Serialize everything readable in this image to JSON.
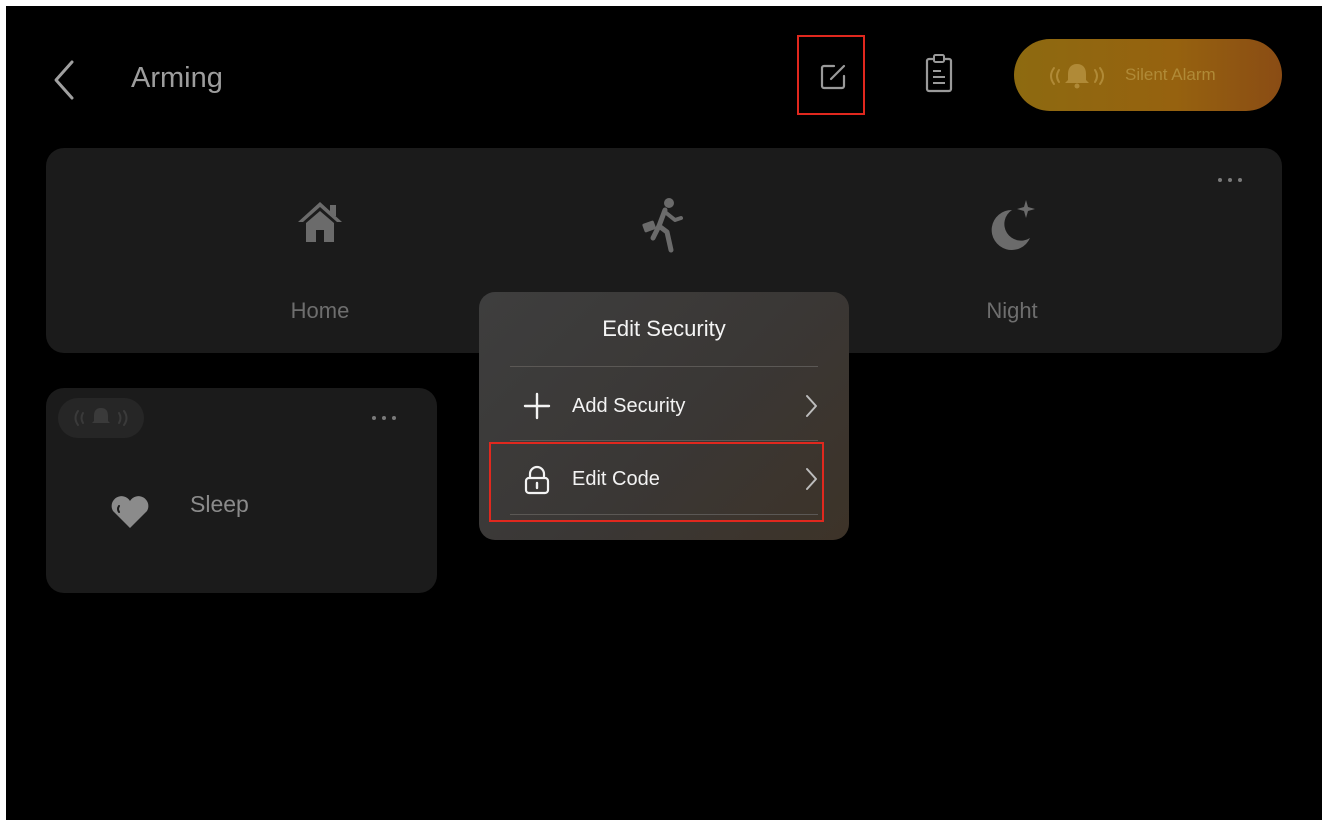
{
  "header": {
    "title": "Arming",
    "silent_alarm_label": "Silent Alarm"
  },
  "modes": [
    {
      "label": "Home",
      "icon": "home-icon"
    },
    {
      "label": "",
      "icon": "away-runner-icon"
    },
    {
      "label": "Night",
      "icon": "moon-star-icon"
    }
  ],
  "scene": {
    "label": "Sleep",
    "icon": "heart-icon"
  },
  "popup": {
    "title": "Edit Security",
    "items": [
      {
        "label": "Add Security",
        "icon": "plus-icon"
      },
      {
        "label": "Edit Code",
        "icon": "lock-icon"
      }
    ]
  },
  "colors": {
    "background": "#000000",
    "card": "#1b1b1b",
    "accent": "#96620f",
    "highlight": "#e0281e"
  }
}
